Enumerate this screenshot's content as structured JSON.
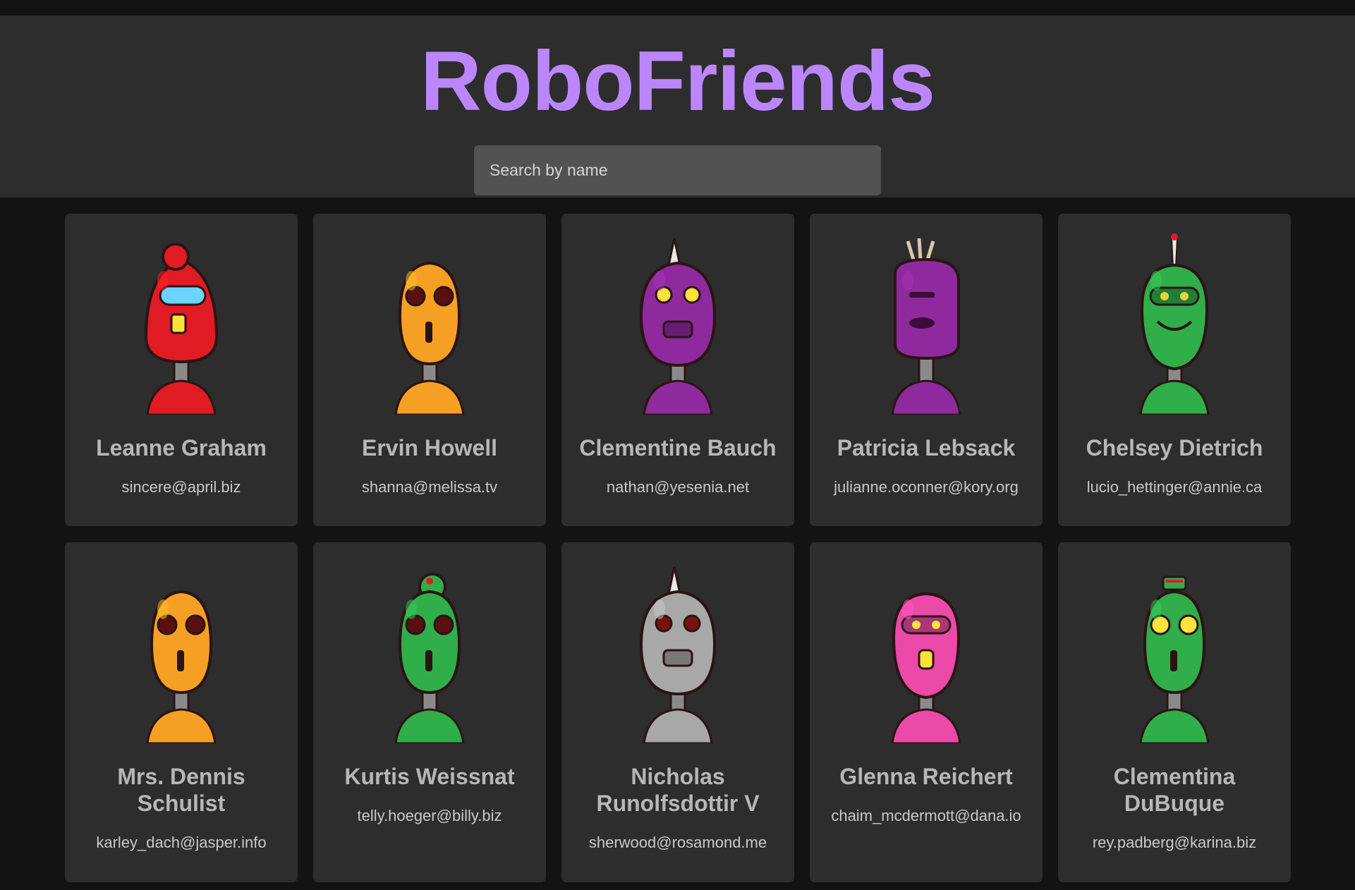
{
  "app": {
    "title": "RoboFriends",
    "search": {
      "placeholder": "Search by name",
      "value": ""
    }
  },
  "robots": [
    {
      "name": "Leanne Graham",
      "email": "sincere@april.biz",
      "body_color": "#e01b24",
      "head": "dome-visor",
      "eye": "#6ad4ff"
    },
    {
      "name": "Ervin Howell",
      "email": "shanna@melissa.tv",
      "body_color": "#f5a025",
      "head": "oval-eyes",
      "eye": "#5a1010"
    },
    {
      "name": "Clementine Bauch",
      "email": "nathan@yesenia.net",
      "body_color": "#8e2a9e",
      "head": "tall-spike",
      "eye": "#ffe23a"
    },
    {
      "name": "Patricia Lebsack",
      "email": "julianne.oconner@kory.org",
      "body_color": "#8e2a9e",
      "head": "square-tuft",
      "eye": "#3a0c3a"
    },
    {
      "name": "Chelsey Dietrich",
      "email": "lucio_hettinger@annie.ca",
      "body_color": "#2fae4a",
      "head": "visor-antenna",
      "eye": "#e8d23a"
    },
    {
      "name": "Mrs. Dennis Schulist",
      "email": "karley_dach@jasper.info",
      "body_color": "#f5a025",
      "head": "oval-eyes",
      "eye": "#5a1010"
    },
    {
      "name": "Kurtis Weissnat",
      "email": "telly.hoeger@billy.biz",
      "body_color": "#2fae4a",
      "head": "dome-eyes",
      "eye": "#5a1010"
    },
    {
      "name": "Nicholas Runolfsdottir V",
      "email": "sherwood@rosamond.me",
      "body_color": "#a8a8a8",
      "head": "spike-eyes",
      "eye": "#7a1010"
    },
    {
      "name": "Glenna Reichert",
      "email": "chaim_mcdermott@dana.io",
      "body_color": "#ec4aa8",
      "head": "visor-tongue",
      "eye": "#ffe23a"
    },
    {
      "name": "Clementina DuBuque",
      "email": "rey.padberg@karina.biz",
      "body_color": "#2fae4a",
      "head": "hat-eyes",
      "eye": "#ffe23a"
    }
  ]
}
